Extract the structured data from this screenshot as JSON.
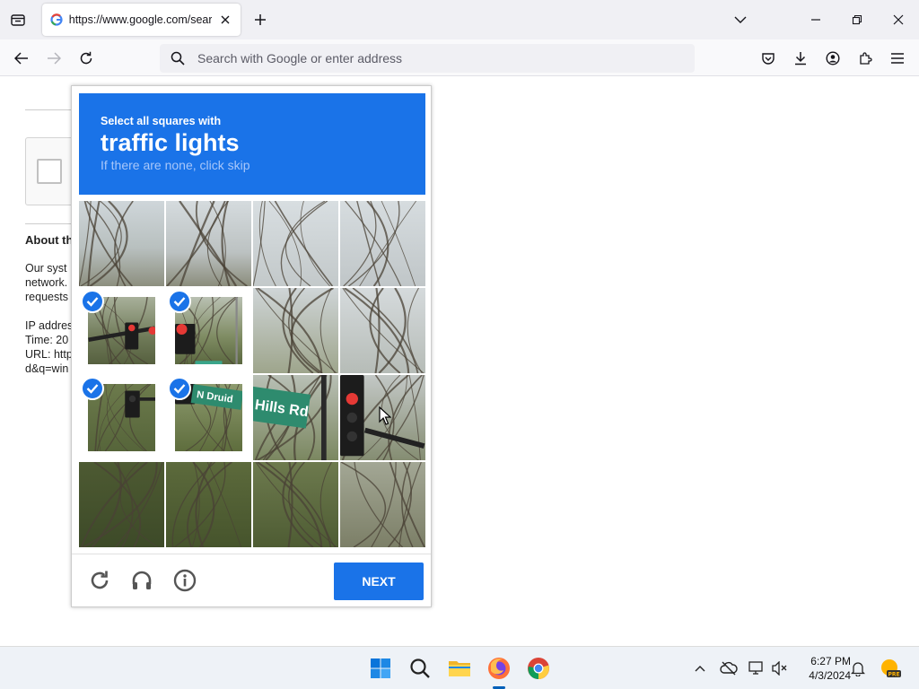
{
  "browser": {
    "tab_title": "https://www.google.com/search",
    "url_placeholder": "Search with Google or enter address"
  },
  "page": {
    "about_heading": "About th",
    "para_lines": [
      "Our syst",
      "network.",
      "requests"
    ],
    "meta_lines": [
      "IP addres",
      "Time: 20",
      "URL: http",
      "d&q=win"
    ]
  },
  "captcha": {
    "instruction": "Select all squares with",
    "target": "traffic lights",
    "hint": "If there are none, click skip",
    "next_label": "NEXT",
    "selected_tiles": [
      4,
      5,
      8,
      9
    ],
    "sign_text_1": "N Druid",
    "sign_text_2": "Hills Rd",
    "colors": {
      "accent": "#1a73e8"
    }
  },
  "taskbar": {
    "time": "6:27 PM",
    "date": "4/3/2024",
    "apps": [
      "windows-start",
      "search",
      "file-explorer",
      "firefox",
      "chrome"
    ],
    "weather_badge": "PRE"
  }
}
